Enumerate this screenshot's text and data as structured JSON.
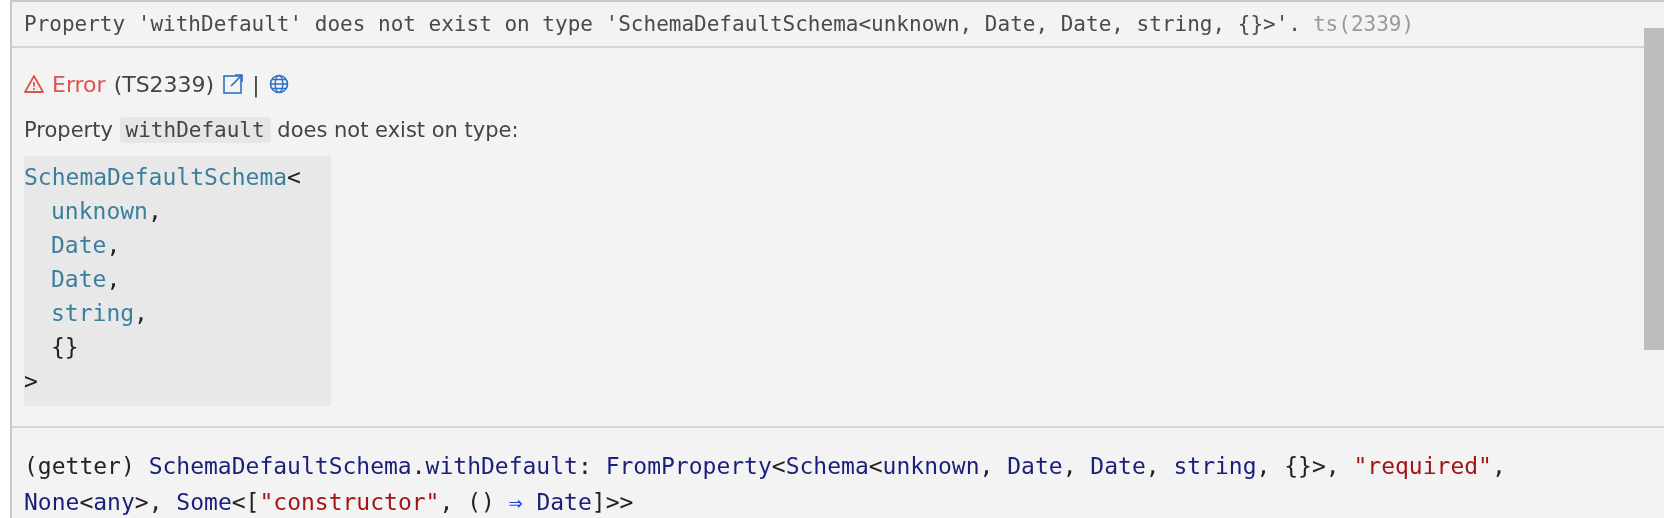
{
  "hover": {
    "message": {
      "text": "Property 'withDefault' does not exist on type 'SchemaDefaultSchema<unknown, Date, Date, string, {}>'.",
      "code": "ts(2339)"
    },
    "error": {
      "severity": "Error",
      "code": "(TS2339)",
      "separator": "|"
    },
    "description": {
      "before": "Property",
      "code": "withDefault",
      "after": "does not exist on type:"
    },
    "type_block": {
      "name": "SchemaDefaultSchema",
      "open": "<",
      "args": [
        {
          "text": "unknown",
          "kind": "type",
          "suffix": ","
        },
        {
          "text": "Date",
          "kind": "type",
          "suffix": ","
        },
        {
          "text": "Date",
          "kind": "type",
          "suffix": ","
        },
        {
          "text": "string",
          "kind": "type",
          "suffix": ","
        },
        {
          "text": "{}",
          "kind": "plain"
        }
      ],
      "close": ">"
    },
    "signature": {
      "lines": [
        [
          {
            "text": "(getter) ",
            "kind": "plain"
          },
          {
            "text": "SchemaDefaultSchema",
            "kind": "type"
          },
          {
            "text": ".",
            "kind": "plain"
          },
          {
            "text": "withDefault",
            "kind": "type"
          },
          {
            "text": ": ",
            "kind": "plain"
          },
          {
            "text": "FromProperty",
            "kind": "type"
          },
          {
            "text": "<",
            "kind": "plain"
          },
          {
            "text": "Schema",
            "kind": "type"
          },
          {
            "text": "<",
            "kind": "plain"
          },
          {
            "text": "unknown",
            "kind": "type"
          },
          {
            "text": ", ",
            "kind": "plain"
          },
          {
            "text": "Date",
            "kind": "type"
          },
          {
            "text": ", ",
            "kind": "plain"
          },
          {
            "text": "Date",
            "kind": "type"
          },
          {
            "text": ", ",
            "kind": "plain"
          },
          {
            "text": "string",
            "kind": "type"
          },
          {
            "text": ", {}>, ",
            "kind": "plain"
          },
          {
            "text": "\"required\"",
            "kind": "string"
          },
          {
            "text": ",",
            "kind": "plain"
          }
        ],
        [
          {
            "text": "None",
            "kind": "type"
          },
          {
            "text": "<",
            "kind": "plain"
          },
          {
            "text": "any",
            "kind": "type"
          },
          {
            "text": ">, ",
            "kind": "plain"
          },
          {
            "text": "Some",
            "kind": "type"
          },
          {
            "text": "<[",
            "kind": "plain"
          },
          {
            "text": "\"constructor\"",
            "kind": "string"
          },
          {
            "text": ", () ",
            "kind": "plain"
          },
          {
            "text": "⇒ ",
            "kind": "operator"
          },
          {
            "text": "Date",
            "kind": "type"
          },
          {
            "text": "]>>",
            "kind": "plain"
          }
        ]
      ]
    }
  }
}
